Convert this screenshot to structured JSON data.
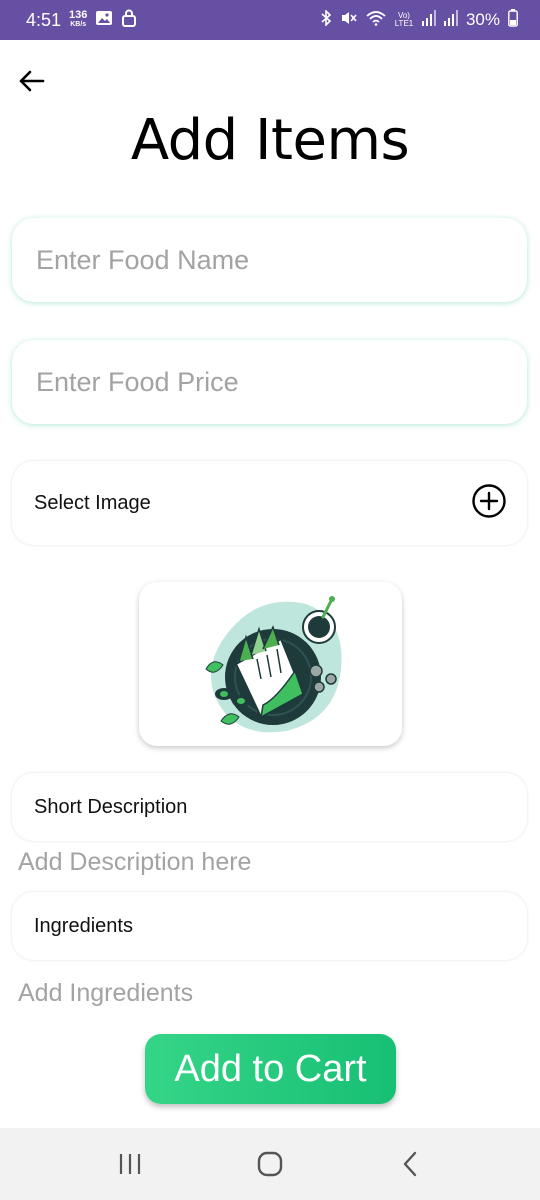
{
  "status_bar": {
    "time": "4:51",
    "data_speed_value": "136",
    "data_speed_unit": "KB/s",
    "network_label": "Vo) LTE1",
    "battery": "30%",
    "icons": [
      "gallery-icon",
      "lock-icon",
      "bluetooth-icon",
      "mute-icon",
      "wifi-icon",
      "signal-icon",
      "signal-icon",
      "battery-icon"
    ]
  },
  "page": {
    "title": "Add Items"
  },
  "form": {
    "food_name_placeholder": "Enter Food Name",
    "food_price_placeholder": "Enter Food Price",
    "select_image_label": "Select Image",
    "short_description_label": "Short Description",
    "description_placeholder": "Add Description here",
    "ingredients_label": "Ingredients",
    "ingredients_placeholder": "Add Ingredients",
    "submit_label": "Add to Cart"
  },
  "colors": {
    "status_bar": "#6650a4",
    "accent_green": "#1fc77a",
    "input_glow": "#5ac8aa"
  }
}
